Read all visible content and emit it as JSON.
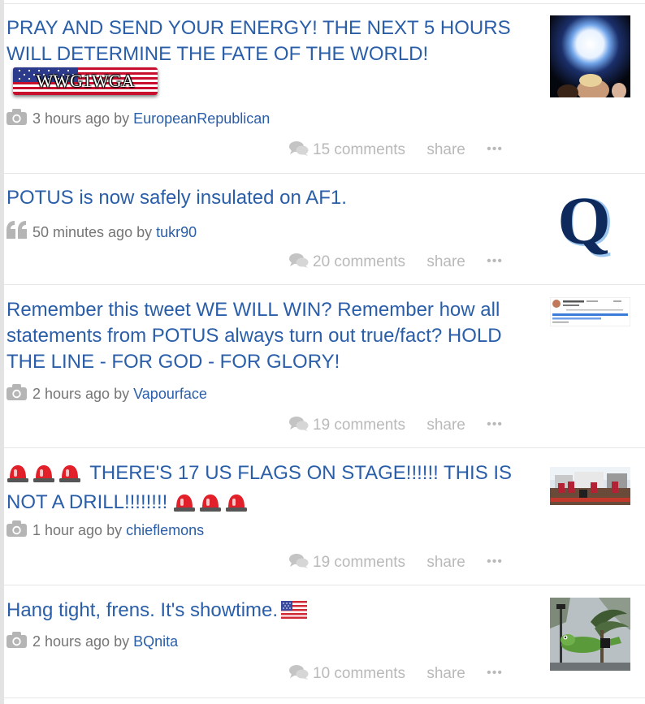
{
  "posts": [
    {
      "title": "PRAY AND SEND YOUR ENERGY! THE NEXT 5 HOURS WILL DETERMINE THE FATE OF THE WORLD!",
      "badge_text": "WWG1WGA",
      "time": "3 hours ago",
      "by": "by",
      "author": "EuropeanRepublican",
      "meta_icon": "camera-icon",
      "comments": "15 comments",
      "share": "share",
      "more": "•••",
      "thumbnail": "glowing-orb-over-speaker"
    },
    {
      "title": "POTUS is now safely insulated on AF1.",
      "time": "50 minutes ago",
      "by": "by",
      "author": "tukr90",
      "meta_icon": "quote-icon",
      "comments": "20 comments",
      "share": "share",
      "more": "•••",
      "thumbnail": "q-logo",
      "thumbnail_letter": "Q"
    },
    {
      "title": "Remember this tweet WE WILL WIN? Remember how all statements from POTUS always turn out true/fact? HOLD THE LINE - FOR GOD - FOR GLORY!",
      "time": "2 hours ago",
      "by": "by",
      "author": "Vapourface",
      "meta_icon": "camera-icon",
      "comments": "19 comments",
      "share": "share",
      "more": "•••",
      "thumbnail": "tweet-screenshot"
    },
    {
      "title_prefix_icons": [
        "siren-emoji",
        "siren-emoji",
        "siren-emoji"
      ],
      "title": "THERE'S 17 US FLAGS ON STAGE!!!!!! THIS IS NOT A DRILL!!!!!!!!",
      "title_suffix_icons": [
        "siren-emoji",
        "siren-emoji",
        "siren-emoji"
      ],
      "time": "1 hour ago",
      "by": "by",
      "author": "chieflemons",
      "meta_icon": "camera-icon",
      "comments": "19 comments",
      "share": "share",
      "more": "•••",
      "thumbnail": "stage-with-flags"
    },
    {
      "title": "Hang tight, frens. It's showtime.",
      "title_suffix_icons": [
        "us-flag-emoji"
      ],
      "time": "2 hours ago",
      "by": "by",
      "author": "BQnita",
      "meta_icon": "camera-icon",
      "comments": "10 comments",
      "share": "share",
      "more": "•••",
      "thumbnail": "frog-in-storm"
    }
  ],
  "colors": {
    "link": "#2a5ea8",
    "meta": "#757575",
    "actions": "#b9b9b9",
    "divider": "#e6e6e6"
  }
}
